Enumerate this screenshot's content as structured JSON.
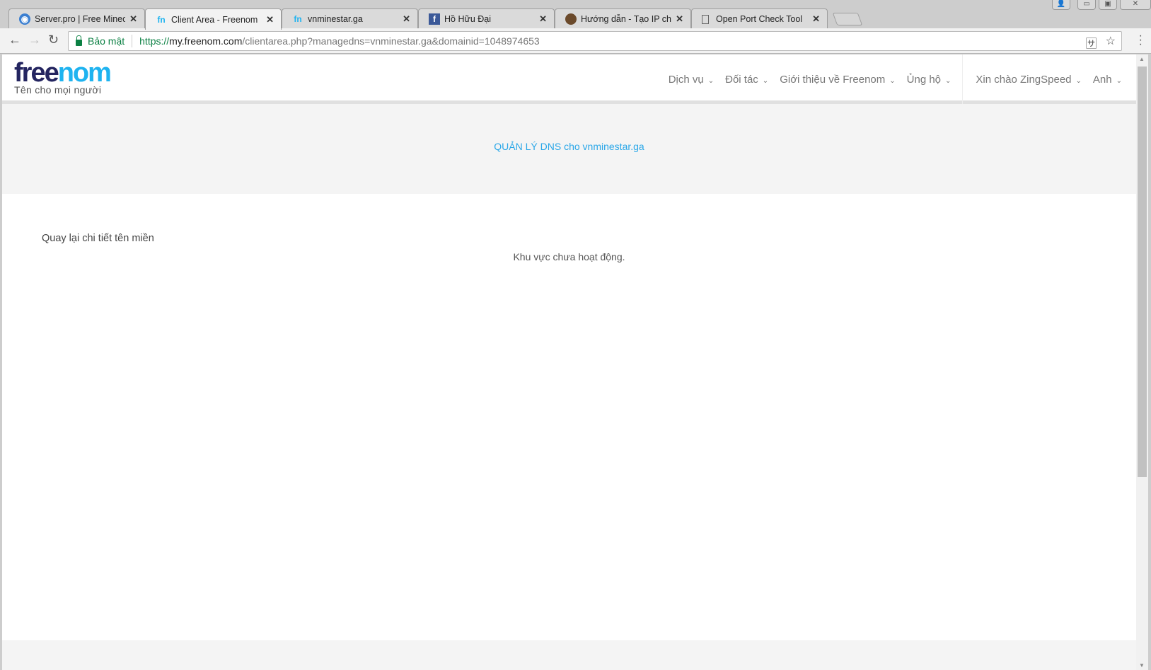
{
  "browser": {
    "tabs": [
      {
        "title": "Server.pro | Free Minecraft",
        "icon": "serverpro-icon",
        "active": false
      },
      {
        "title": "Client Area - Freenom",
        "icon": "freenom-icon",
        "active": true
      },
      {
        "title": "vnminestar.ga",
        "icon": "freenom-icon",
        "active": false
      },
      {
        "title": "Hồ Hữu Đại",
        "icon": "facebook-icon",
        "active": false
      },
      {
        "title": "Hướng dẫn - Tạo IP chữ cho",
        "icon": "minecraft-icon",
        "active": false
      },
      {
        "title": "Open Port Check Tool",
        "icon": "page-icon",
        "active": false
      }
    ],
    "security_label": "Bảo mật",
    "url": {
      "scheme": "https://",
      "host": "my.freenom.com",
      "path": "/clientarea.php?managedns=vnminestar.ga&domainid=1048974653"
    }
  },
  "site": {
    "logo": {
      "free": "free",
      "nom": "nom",
      "tagline": "Tên cho mọi người"
    },
    "nav": [
      "Dịch vụ",
      "Đối tác",
      "Giới thiệu về Freenom",
      "Ủng hộ"
    ],
    "user_menu": "Xin chào ZingSpeed",
    "language": "Anh",
    "accent_color": "#2aa7e8"
  },
  "main": {
    "title": "QUẢN LÝ DNS cho vnminestar.ga",
    "back_link": "Quay lại chi tiết tên miền",
    "notice": "Khu vực chưa hoạt động."
  }
}
